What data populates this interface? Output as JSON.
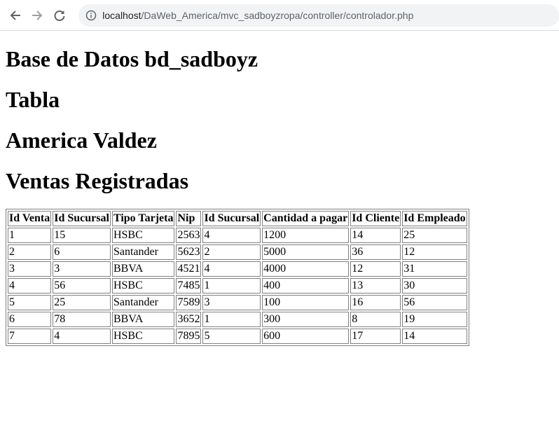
{
  "browser": {
    "url_host": "localhost",
    "url_path": "/DaWeb_America/mvc_sadboyzropa/controller/controlador.php"
  },
  "page": {
    "heading_db": "Base de Datos bd_sadboyz",
    "heading_table": "Tabla",
    "heading_author": "America Valdez",
    "heading_sales": "Ventas Registradas"
  },
  "table": {
    "headers": [
      "Id Venta",
      "Id Sucursal",
      "Tipo Tarjeta",
      "Nip",
      "Id Sucursal",
      "Cantidad a pagar",
      "Id Cliente",
      "Id Empleado"
    ],
    "rows": [
      [
        "1",
        "15",
        "HSBC",
        "2563",
        "4",
        "1200",
        "14",
        "25"
      ],
      [
        "2",
        "6",
        "Santander",
        "5623",
        "2",
        "5000",
        "36",
        "12"
      ],
      [
        "3",
        "3",
        "BBVA",
        "4521",
        "4",
        "4000",
        "12",
        "31"
      ],
      [
        "4",
        "56",
        "HSBC",
        "7485",
        "1",
        "400",
        "13",
        "30"
      ],
      [
        "5",
        "25",
        "Santander",
        "7589",
        "3",
        "100",
        "16",
        "56"
      ],
      [
        "6",
        "78",
        "BBVA",
        "3652",
        "1",
        "300",
        "8",
        "19"
      ],
      [
        "7",
        "4",
        "HSBC",
        "7895",
        "5",
        "600",
        "17",
        "14"
      ]
    ]
  },
  "icons": {
    "back": "back-arrow-icon",
    "forward": "forward-arrow-icon",
    "reload": "reload-icon",
    "info": "info-icon"
  },
  "colors": {
    "omnibox_bg": "#f1f3f4",
    "table_border": "#808080",
    "url_path": "#5f6368"
  }
}
